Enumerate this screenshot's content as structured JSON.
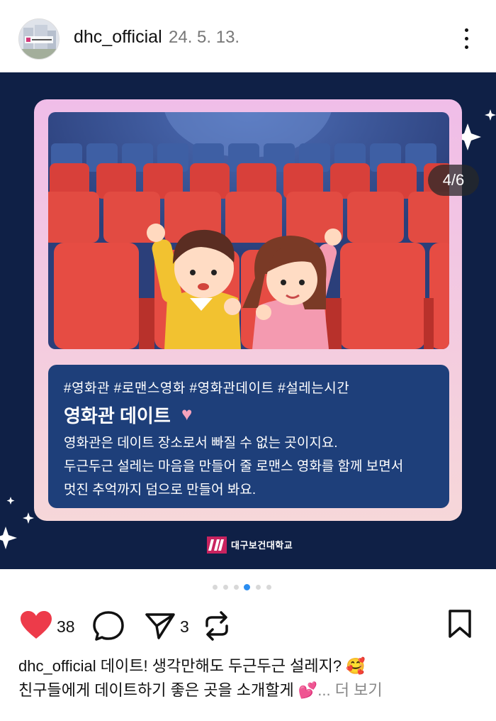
{
  "header": {
    "username": "dhc_official",
    "date": "24. 5. 13."
  },
  "post": {
    "counter": "4/6",
    "tags": "#영화관 #로맨스영화 #영화관데이트 #설레는시간",
    "title": "영화관 데이트",
    "desc": [
      "영화관은 데이트 장소로서 빠질 수 없는 곳이지요.",
      "두근두근 설레는 마음을 만들어 줄 로맨스 영화를 함께 보면서",
      "멋진 추억까지 덤으로 만들어 봐요."
    ],
    "logo_text": "대구보건대학교"
  },
  "pagination": {
    "total": 6,
    "active": 4
  },
  "actions": {
    "likes": "38",
    "shares": "3"
  },
  "caption": {
    "username": "dhc_official",
    "line1": "데이트! 생각만해도 두근두근 설레지? 🥰",
    "line2": "친구들에게 데이트하기 좋은 곳을 소개할게 💕",
    "more": "... 더 보기"
  },
  "colors": {
    "background": "#0f2046",
    "card_border": "#f3c6e6",
    "text_box": "#1e3f7a",
    "seat_red": "#e2473f",
    "like_red": "#ed3b4a",
    "active_dot": "#2b8df0"
  },
  "icons": [
    "heart-icon",
    "comment-icon",
    "send-icon",
    "repost-icon",
    "bookmark-icon",
    "more-icon"
  ]
}
